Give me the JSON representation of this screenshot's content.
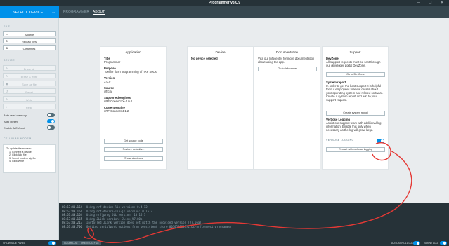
{
  "window": {
    "title": "Programmer v3.0.9"
  },
  "topbar": {
    "select_device": "SELECT DEVICE",
    "tabs": [
      {
        "label": "PROGRAMMER"
      },
      {
        "label": "ABOUT"
      }
    ]
  },
  "sidebar": {
    "file_title": "FILE",
    "file_buttons": [
      {
        "label": "Add file"
      },
      {
        "label": "Reload files"
      },
      {
        "label": "Clear files"
      }
    ],
    "device_title": "DEVICE",
    "device_buttons": [
      {
        "label": "Erase all"
      },
      {
        "label": "Erase & write"
      },
      {
        "label": "Save as file"
      },
      {
        "label": "Reset"
      },
      {
        "label": "Write"
      },
      {
        "label": "Read"
      }
    ],
    "toggles": [
      {
        "label": "Auto read memory"
      },
      {
        "label": "Auto Reset"
      },
      {
        "label": "Enable MCUboot"
      }
    ],
    "modem_title": "CELLULAR MODEM",
    "modem": {
      "heading": "To update the modem:",
      "steps": [
        "Connect a device",
        "Click Add file",
        "Select modem zip file",
        "Click Write"
      ]
    }
  },
  "about": {
    "application": {
      "title": "Application",
      "fields": [
        {
          "label": "Title",
          "value": "Programmer"
        },
        {
          "label": "Purpose",
          "value": "Tool for flash programming of nRF SoCs"
        },
        {
          "label": "Version",
          "value": "3.0.9"
        },
        {
          "label": "Source",
          "value": "official"
        },
        {
          "label": "Supported engines",
          "value": "nRF Connect >=4.0.0"
        },
        {
          "label": "Current engine",
          "value": "nRF Connect 4.1.2"
        }
      ],
      "buttons": [
        "Get source code",
        "Restore defaults...",
        "Show shortcuts"
      ]
    },
    "device": {
      "title": "Device",
      "status": "No device selected"
    },
    "documentation": {
      "title": "Documentation",
      "text": "Visit our Infocenter for more documentation about using the app.",
      "button": "Go to Infocenter"
    },
    "support": {
      "title": "Support",
      "devzone_label": "DevZone",
      "devzone_text": "All support requests must be sent through our developer portal DevZone.",
      "devzone_button": "Go to DevZone",
      "report_label": "System report",
      "report_text": "In order to get the best support it is helpful for our employees to know details about your operating system and related software. Create a system report and add to your support request.",
      "report_button": "Create system report",
      "logging_label": "Verbose Logging",
      "logging_text": "Assist our support team with additional log information. Enable this only when necessary as the log will grow large.",
      "verbose_toggle": "VERBOSE LOGGING",
      "restart_button": "Restart with verbose logging"
    }
  },
  "log": [
    {
      "time": "08:53:40.164",
      "msg": "Using nrf-device-lib version: 0.4.12"
    },
    {
      "time": "08:53:40.164",
      "msg": "Using nrf-device-lib-js version: 0.15.3"
    },
    {
      "time": "08:53:40.164",
      "msg": "Using nrfjprog DLL version: 10.15.1"
    },
    {
      "time": "08:53:40.165",
      "msg": "Using JLink version: JLink_V7.80b"
    },
    {
      "time": "08:53:40.213",
      "msg": "Installed JLink version does not match the provided version (V7.66a)"
    },
    {
      "time": "08:53:40.706",
      "msg": "Getting serialport options from persistent store 001050084572.pc-nrfconnect-programmer"
    }
  ],
  "statusbar": {
    "show_side_panel": "SHOW SIDE PANEL",
    "clear_log": "CLEAR LOG",
    "open_log_file": "OPEN LOG FILE",
    "autoscroll": "AUTOSCROLL LOG",
    "show_log": "SHOW LOG"
  },
  "colors": {
    "accent": "#0091ea",
    "dark": "#263238",
    "annotation": "#e53935"
  }
}
